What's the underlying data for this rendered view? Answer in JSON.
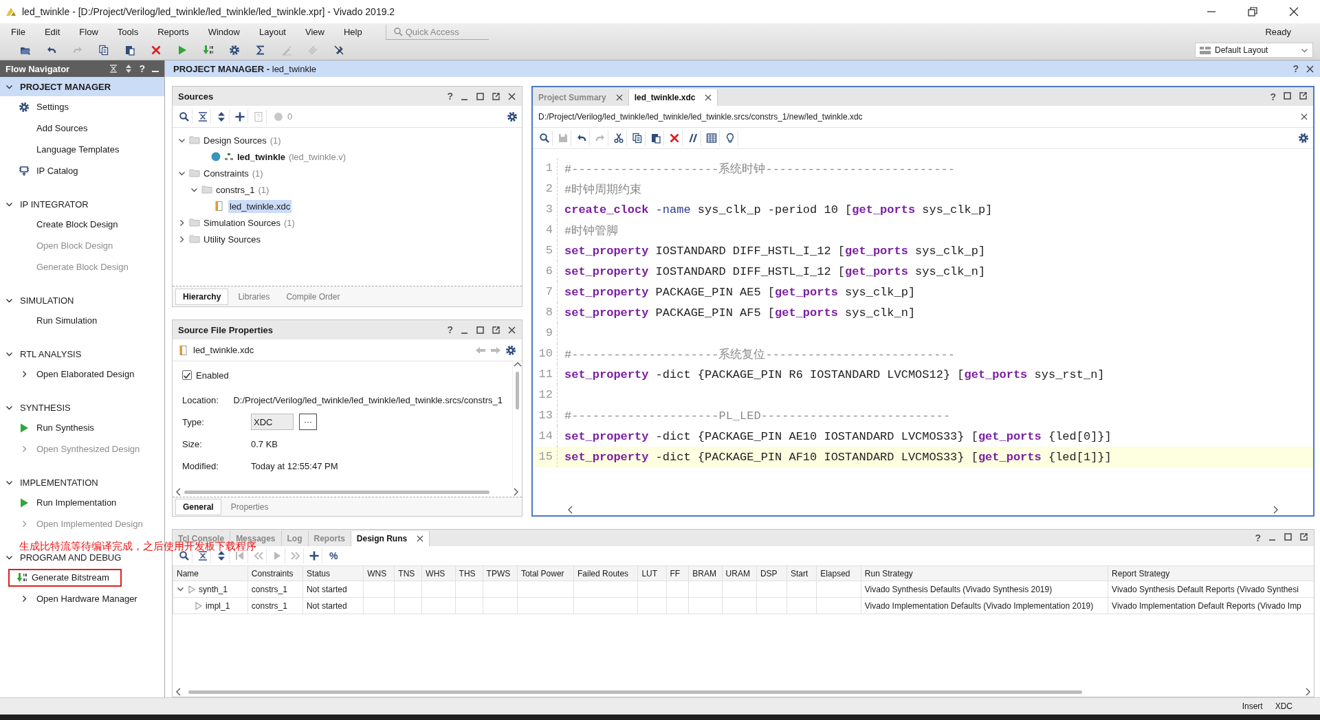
{
  "window": {
    "title": "led_twinkle - [D:/Project/Verilog/led_twinkle/led_twinkle/led_twinkle.xpr] - Vivado 2019.2"
  },
  "menu": [
    "File",
    "Edit",
    "Flow",
    "Tools",
    "Reports",
    "Window",
    "Layout",
    "View",
    "Help"
  ],
  "quick_access": {
    "placeholder": "Quick Access"
  },
  "toolbar": [
    {
      "kind": "open",
      "disabled": false
    },
    {
      "kind": "undo",
      "disabled": false
    },
    {
      "kind": "redo",
      "disabled": true
    },
    {
      "kind": "copy",
      "disabled": false
    },
    {
      "kind": "paste",
      "disabled": false
    },
    {
      "kind": "delete",
      "disabled": false
    },
    {
      "kind": "run",
      "disabled": false
    },
    {
      "kind": "bitstream",
      "disabled": false
    },
    {
      "kind": "settings",
      "disabled": false
    },
    {
      "kind": "sigma",
      "disabled": false
    },
    {
      "kind": "pen",
      "disabled": true
    },
    {
      "kind": "probe",
      "disabled": true
    },
    {
      "kind": "unprobe",
      "disabled": false
    }
  ],
  "status": "Ready",
  "layout_select": {
    "value": "Default Layout"
  },
  "flow_navigator": {
    "title": "Flow Navigator",
    "help": "?",
    "sections": [
      {
        "title": "PROJECT MANAGER",
        "expanded": true,
        "selected": true,
        "items": [
          {
            "label": "Settings",
            "kind": "settings",
            "disabled": false,
            "highlighted": false
          },
          {
            "label": "Add Sources",
            "kind": "plain",
            "disabled": false,
            "highlighted": false
          },
          {
            "label": "Language Templates",
            "kind": "plain",
            "disabled": false,
            "highlighted": false
          },
          {
            "label": "IP Catalog",
            "kind": "ip",
            "disabled": false,
            "highlighted": false
          }
        ]
      },
      {
        "title": "IP INTEGRATOR",
        "expanded": true,
        "selected": false,
        "items": [
          {
            "label": "Create Block Design",
            "kind": "plain",
            "disabled": false,
            "highlighted": false
          },
          {
            "label": "Open Block Design",
            "kind": "plain",
            "disabled": true,
            "highlighted": false
          },
          {
            "label": "Generate Block Design",
            "kind": "plain",
            "disabled": true,
            "highlighted": false
          }
        ]
      },
      {
        "title": "SIMULATION",
        "expanded": true,
        "selected": false,
        "items": [
          {
            "label": "Run Simulation",
            "kind": "plain",
            "disabled": false,
            "highlighted": false
          }
        ]
      },
      {
        "title": "RTL ANALYSIS",
        "expanded": true,
        "selected": false,
        "items": [
          {
            "label": "Open Elaborated Design",
            "kind": "expander",
            "disabled": false,
            "highlighted": false
          }
        ]
      },
      {
        "title": "SYNTHESIS",
        "expanded": true,
        "selected": false,
        "items": [
          {
            "label": "Run Synthesis",
            "kind": "run",
            "disabled": false,
            "highlighted": false
          },
          {
            "label": "Open Synthesized Design",
            "kind": "expander",
            "disabled": true,
            "highlighted": false
          }
        ]
      },
      {
        "title": "IMPLEMENTATION",
        "expanded": true,
        "selected": false,
        "items": [
          {
            "label": "Run Implementation",
            "kind": "run",
            "disabled": false,
            "highlighted": false
          },
          {
            "label": "Open Implemented Design",
            "kind": "expander",
            "disabled": true,
            "highlighted": false
          }
        ]
      },
      {
        "title": "PROGRAM AND DEBUG",
        "expanded": true,
        "selected": false,
        "items": [
          {
            "label": "Generate Bitstream",
            "kind": "bitstream",
            "disabled": false,
            "highlighted": true
          },
          {
            "label": "Open Hardware Manager",
            "kind": "expander",
            "disabled": false,
            "highlighted": false
          }
        ]
      }
    ]
  },
  "breadcrumb": {
    "title": "**PROJECT MANAGER -** led_twinkle",
    "help": "?"
  },
  "sources": {
    "title": "Sources",
    "help": "?",
    "toolbar": [
      {
        "kind": "search",
        "disabled": false
      },
      {
        "kind": "collapse",
        "disabled": false
      },
      {
        "kind": "expand",
        "disabled": false
      },
      {
        "kind": "add",
        "disabled": false
      },
      {
        "kind": "unknown",
        "disabled": true
      }
    ],
    "status_count": "0",
    "tree": [
      {
        "label": "Design Sources",
        "count": "(1)",
        "kind": "folder",
        "expanded": true,
        "selected": false,
        "children": [
          {
            "label": "led_twinkle",
            "detail": "(led_twinkle.v)",
            "kind": "module",
            "selected": false
          }
        ]
      },
      {
        "label": "Constraints",
        "count": "(1)",
        "kind": "folder",
        "expanded": true,
        "selected": false,
        "children": [
          {
            "label": "constrs_1",
            "count": "(1)",
            "kind": "folder",
            "expanded": true,
            "selected": false,
            "children": [
              {
                "label": "led_twinkle.xdc",
                "kind": "file",
                "selected": true
              }
            ]
          }
        ]
      },
      {
        "label": "Simulation Sources",
        "count": "(1)",
        "kind": "folder",
        "expanded": false,
        "selected": false
      },
      {
        "label": "Utility Sources",
        "kind": "folder",
        "expanded": false,
        "selected": false
      }
    ],
    "tabs": [
      {
        "label": "Hierarchy",
        "selected": true
      },
      {
        "label": "Libraries",
        "selected": false
      },
      {
        "label": "Compile Order",
        "selected": false
      }
    ]
  },
  "source_properties": {
    "title": "Source File Properties",
    "help": "?",
    "file": "led_twinkle.xdc",
    "enabled": {
      "label": "Enabled",
      "checked": true
    },
    "fields": [
      {
        "label": "Location:",
        "value": "D:/Project/Verilog/led_twinkle/led_twinkle/led_twinkle.srcs/constrs_1",
        "kind": "text"
      },
      {
        "label": "Type:",
        "value": "XDC",
        "kind": "select",
        "button": "···"
      },
      {
        "label": "Size:",
        "value": "0.7 KB",
        "kind": "text"
      },
      {
        "label": "Modified:",
        "value": "Today at 12:55:47 PM",
        "kind": "text"
      }
    ],
    "tabs": [
      {
        "label": "General",
        "selected": true
      },
      {
        "label": "Properties",
        "selected": false
      }
    ]
  },
  "editor": {
    "tabs": [
      {
        "label": "Project Summary",
        "selected": false
      },
      {
        "label": "led_twinkle.xdc",
        "selected": true
      }
    ],
    "help": "?",
    "path": "D:/Project/Verilog/led_twinkle/led_twinkle/led_twinkle.srcs/constrs_1/new/led_twinkle.xdc",
    "toolbar": [
      {
        "kind": "search",
        "disabled": false
      },
      {
        "kind": "save",
        "disabled": true
      },
      {
        "kind": "undo",
        "disabled": false
      },
      {
        "kind": "redo",
        "disabled": true
      },
      {
        "kind": "cut",
        "disabled": false
      },
      {
        "kind": "copy",
        "disabled": false
      },
      {
        "kind": "paste",
        "disabled": false
      },
      {
        "kind": "delete",
        "disabled": false
      },
      {
        "kind": "comment",
        "disabled": false
      },
      {
        "kind": "columns",
        "disabled": false
      },
      {
        "kind": "bulb",
        "disabled": false
      }
    ],
    "lines": [
      {
        "number": "1",
        "current": false,
        "tokens": [
          {
            "kind": "comment",
            "text": "#---------------------系统时钟---------------------------"
          }
        ]
      },
      {
        "number": "2",
        "current": false,
        "tokens": [
          {
            "kind": "comment",
            "text": "#时钟周期约束"
          }
        ]
      },
      {
        "number": "3",
        "current": false,
        "tokens": [
          {
            "kind": "command",
            "text": "create_clock"
          },
          {
            "kind": "option",
            "text": " -name"
          },
          {
            "kind": "plain",
            "text": " sys_clk_p -period 10 ["
          },
          {
            "kind": "command",
            "text": "get_ports"
          },
          {
            "kind": "plain",
            "text": " sys_clk_p]"
          }
        ]
      },
      {
        "number": "4",
        "current": false,
        "tokens": [
          {
            "kind": "comment",
            "text": "#时钟管脚"
          }
        ]
      },
      {
        "number": "5",
        "current": false,
        "tokens": [
          {
            "kind": "command",
            "text": "set_property"
          },
          {
            "kind": "plain",
            "text": " IOSTANDARD DIFF_HSTL_I_12 ["
          },
          {
            "kind": "command",
            "text": "get_ports"
          },
          {
            "kind": "plain",
            "text": " sys_clk_p]"
          }
        ]
      },
      {
        "number": "6",
        "current": false,
        "tokens": [
          {
            "kind": "command",
            "text": "set_property"
          },
          {
            "kind": "plain",
            "text": " IOSTANDARD DIFF_HSTL_I_12 ["
          },
          {
            "kind": "command",
            "text": "get_ports"
          },
          {
            "kind": "plain",
            "text": " sys_clk_n]"
          }
        ]
      },
      {
        "number": "7",
        "current": false,
        "tokens": [
          {
            "kind": "command",
            "text": "set_property"
          },
          {
            "kind": "plain",
            "text": " PACKAGE_PIN AE5 ["
          },
          {
            "kind": "command",
            "text": "get_ports"
          },
          {
            "kind": "plain",
            "text": " sys_clk_p]"
          }
        ]
      },
      {
        "number": "8",
        "current": false,
        "tokens": [
          {
            "kind": "command",
            "text": "set_property"
          },
          {
            "kind": "plain",
            "text": " PACKAGE_PIN AF5 ["
          },
          {
            "kind": "command",
            "text": "get_ports"
          },
          {
            "kind": "plain",
            "text": " sys_clk_n]"
          }
        ]
      },
      {
        "number": "9",
        "current": false
      },
      {
        "number": "10",
        "current": false,
        "tokens": [
          {
            "kind": "comment",
            "text": "#---------------------系统复位---------------------------"
          }
        ]
      },
      {
        "number": "11",
        "current": false,
        "tokens": [
          {
            "kind": "command",
            "text": "set_property"
          },
          {
            "kind": "plain",
            "text": " -dict {PACKAGE_PIN R6 IOSTANDARD LVCMOS12} ["
          },
          {
            "kind": "command",
            "text": "get_ports"
          },
          {
            "kind": "plain",
            "text": " sys_rst_n]"
          }
        ]
      },
      {
        "number": "12",
        "current": false
      },
      {
        "number": "13",
        "current": false,
        "tokens": [
          {
            "kind": "comment",
            "text": "#---------------------PL_LED---------------------------"
          }
        ]
      },
      {
        "number": "14",
        "current": false,
        "tokens": [
          {
            "kind": "command",
            "text": "set_property"
          },
          {
            "kind": "plain",
            "text": " -dict {PACKAGE_PIN AE10 IOSTANDARD LVCMOS33} ["
          },
          {
            "kind": "command",
            "text": "get_ports"
          },
          {
            "kind": "plain",
            "text": " {led[0]}]"
          }
        ]
      },
      {
        "number": "15",
        "current": true,
        "tokens": [
          {
            "kind": "command",
            "text": "set_property"
          },
          {
            "kind": "plain",
            "text": " -dict {PACKAGE_PIN AF10 IOSTANDARD LVCMOS33} ["
          },
          {
            "kind": "command",
            "text": "get_ports"
          },
          {
            "kind": "plain",
            "text": " {led[1]}]"
          }
        ]
      }
    ]
  },
  "runs": {
    "tabs": [
      {
        "label": "Tcl Console",
        "selected": false
      },
      {
        "label": "Messages",
        "selected": false
      },
      {
        "label": "Log",
        "selected": false
      },
      {
        "label": "Reports",
        "selected": false
      },
      {
        "label": "Design Runs",
        "selected": true
      }
    ],
    "help": "?",
    "toolbar": [
      {
        "kind": "search",
        "disabled": false
      },
      {
        "kind": "collapse",
        "disabled": false
      },
      {
        "kind": "expand",
        "disabled": false
      },
      {
        "kind": "first",
        "disabled": true
      },
      {
        "kind": "prev",
        "disabled": true
      },
      {
        "kind": "play",
        "disabled": true
      },
      {
        "kind": "next",
        "disabled": true
      },
      {
        "kind": "add",
        "disabled": false
      }
    ],
    "percent": "%",
    "columns": [
      "Name",
      "Constraints",
      "Status",
      "WNS",
      "TNS",
      "WHS",
      "THS",
      "TPWS",
      "Total Power",
      "Failed Routes",
      "LUT",
      "FF",
      "BRAM",
      "URAM",
      "DSP",
      "Start",
      "Elapsed",
      "Run Strategy",
      "Report Strategy"
    ],
    "rows": [
      {
        "name": "synth_1",
        "kind": "parent",
        "expanded": true,
        "constraints": "constrs_1",
        "status": "Not started",
        "run_strategy": "Vivado Synthesis Defaults (Vivado Synthesis 2019)",
        "report_strategy": "Vivado Synthesis Default Reports (Vivado Synthesi"
      },
      {
        "name": "impl_1",
        "kind": "child",
        "constraints": "constrs_1",
        "status": "Not started",
        "run_strategy": "Vivado Implementation Defaults (Vivado Implementation 2019)",
        "report_strategy": "Vivado Implementation Default Reports (Vivado Imp"
      }
    ]
  },
  "annotation": {
    "text": "生成比特流等待编译完成，之后使用开发板下载程序"
  },
  "status_bar": {
    "mode": "Insert",
    "file_type": "XDC"
  }
}
